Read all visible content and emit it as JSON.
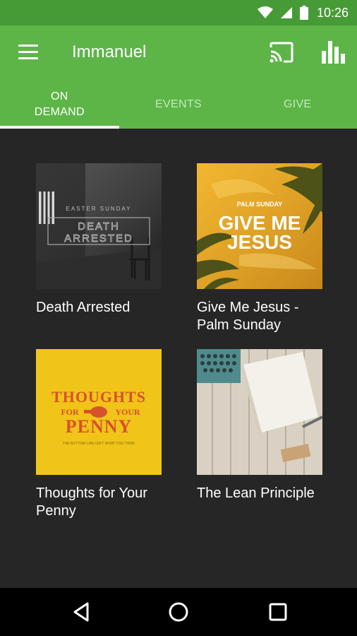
{
  "status_bar": {
    "time": "10:26",
    "icons": [
      "wifi-icon",
      "signal-icon",
      "battery-icon"
    ]
  },
  "app_bar": {
    "title": "Immanuel",
    "icons": [
      "menu-icon",
      "cast-icon",
      "bar-chart-icon"
    ]
  },
  "tabs": [
    {
      "label": "ON DEMAND",
      "active": true
    },
    {
      "label": "EVENTS",
      "active": false
    },
    {
      "label": "GIVE",
      "active": false
    }
  ],
  "items": [
    {
      "title": "Death Arrested",
      "art": {
        "kicker": "EASTER SUNDAY",
        "headline_1": "DEATH",
        "headline_2": "ARRESTED"
      }
    },
    {
      "title": "Give Me Jesus - Palm Sunday",
      "art": {
        "kicker": "PALM SUNDAY",
        "headline_1": "GIVE ME",
        "headline_2": "JESUS"
      }
    },
    {
      "title": "Thoughts for Your Penny",
      "art": {
        "headline_1": "THOUGHTS",
        "word_left": "FOR",
        "word_right": "YOUR",
        "headline_2": "PENNY",
        "tagline": "THE BOTTOM LINE ISN'T WHAT YOU THINK"
      }
    },
    {
      "title": "The Lean Principle",
      "art": {}
    }
  ],
  "nav_bar": {
    "icons": [
      "back-icon",
      "home-icon",
      "recents-icon"
    ]
  },
  "colors": {
    "status_bar": "#479b37",
    "app_bar": "#5db548",
    "background": "#262626",
    "nav_bar": "#000000"
  }
}
